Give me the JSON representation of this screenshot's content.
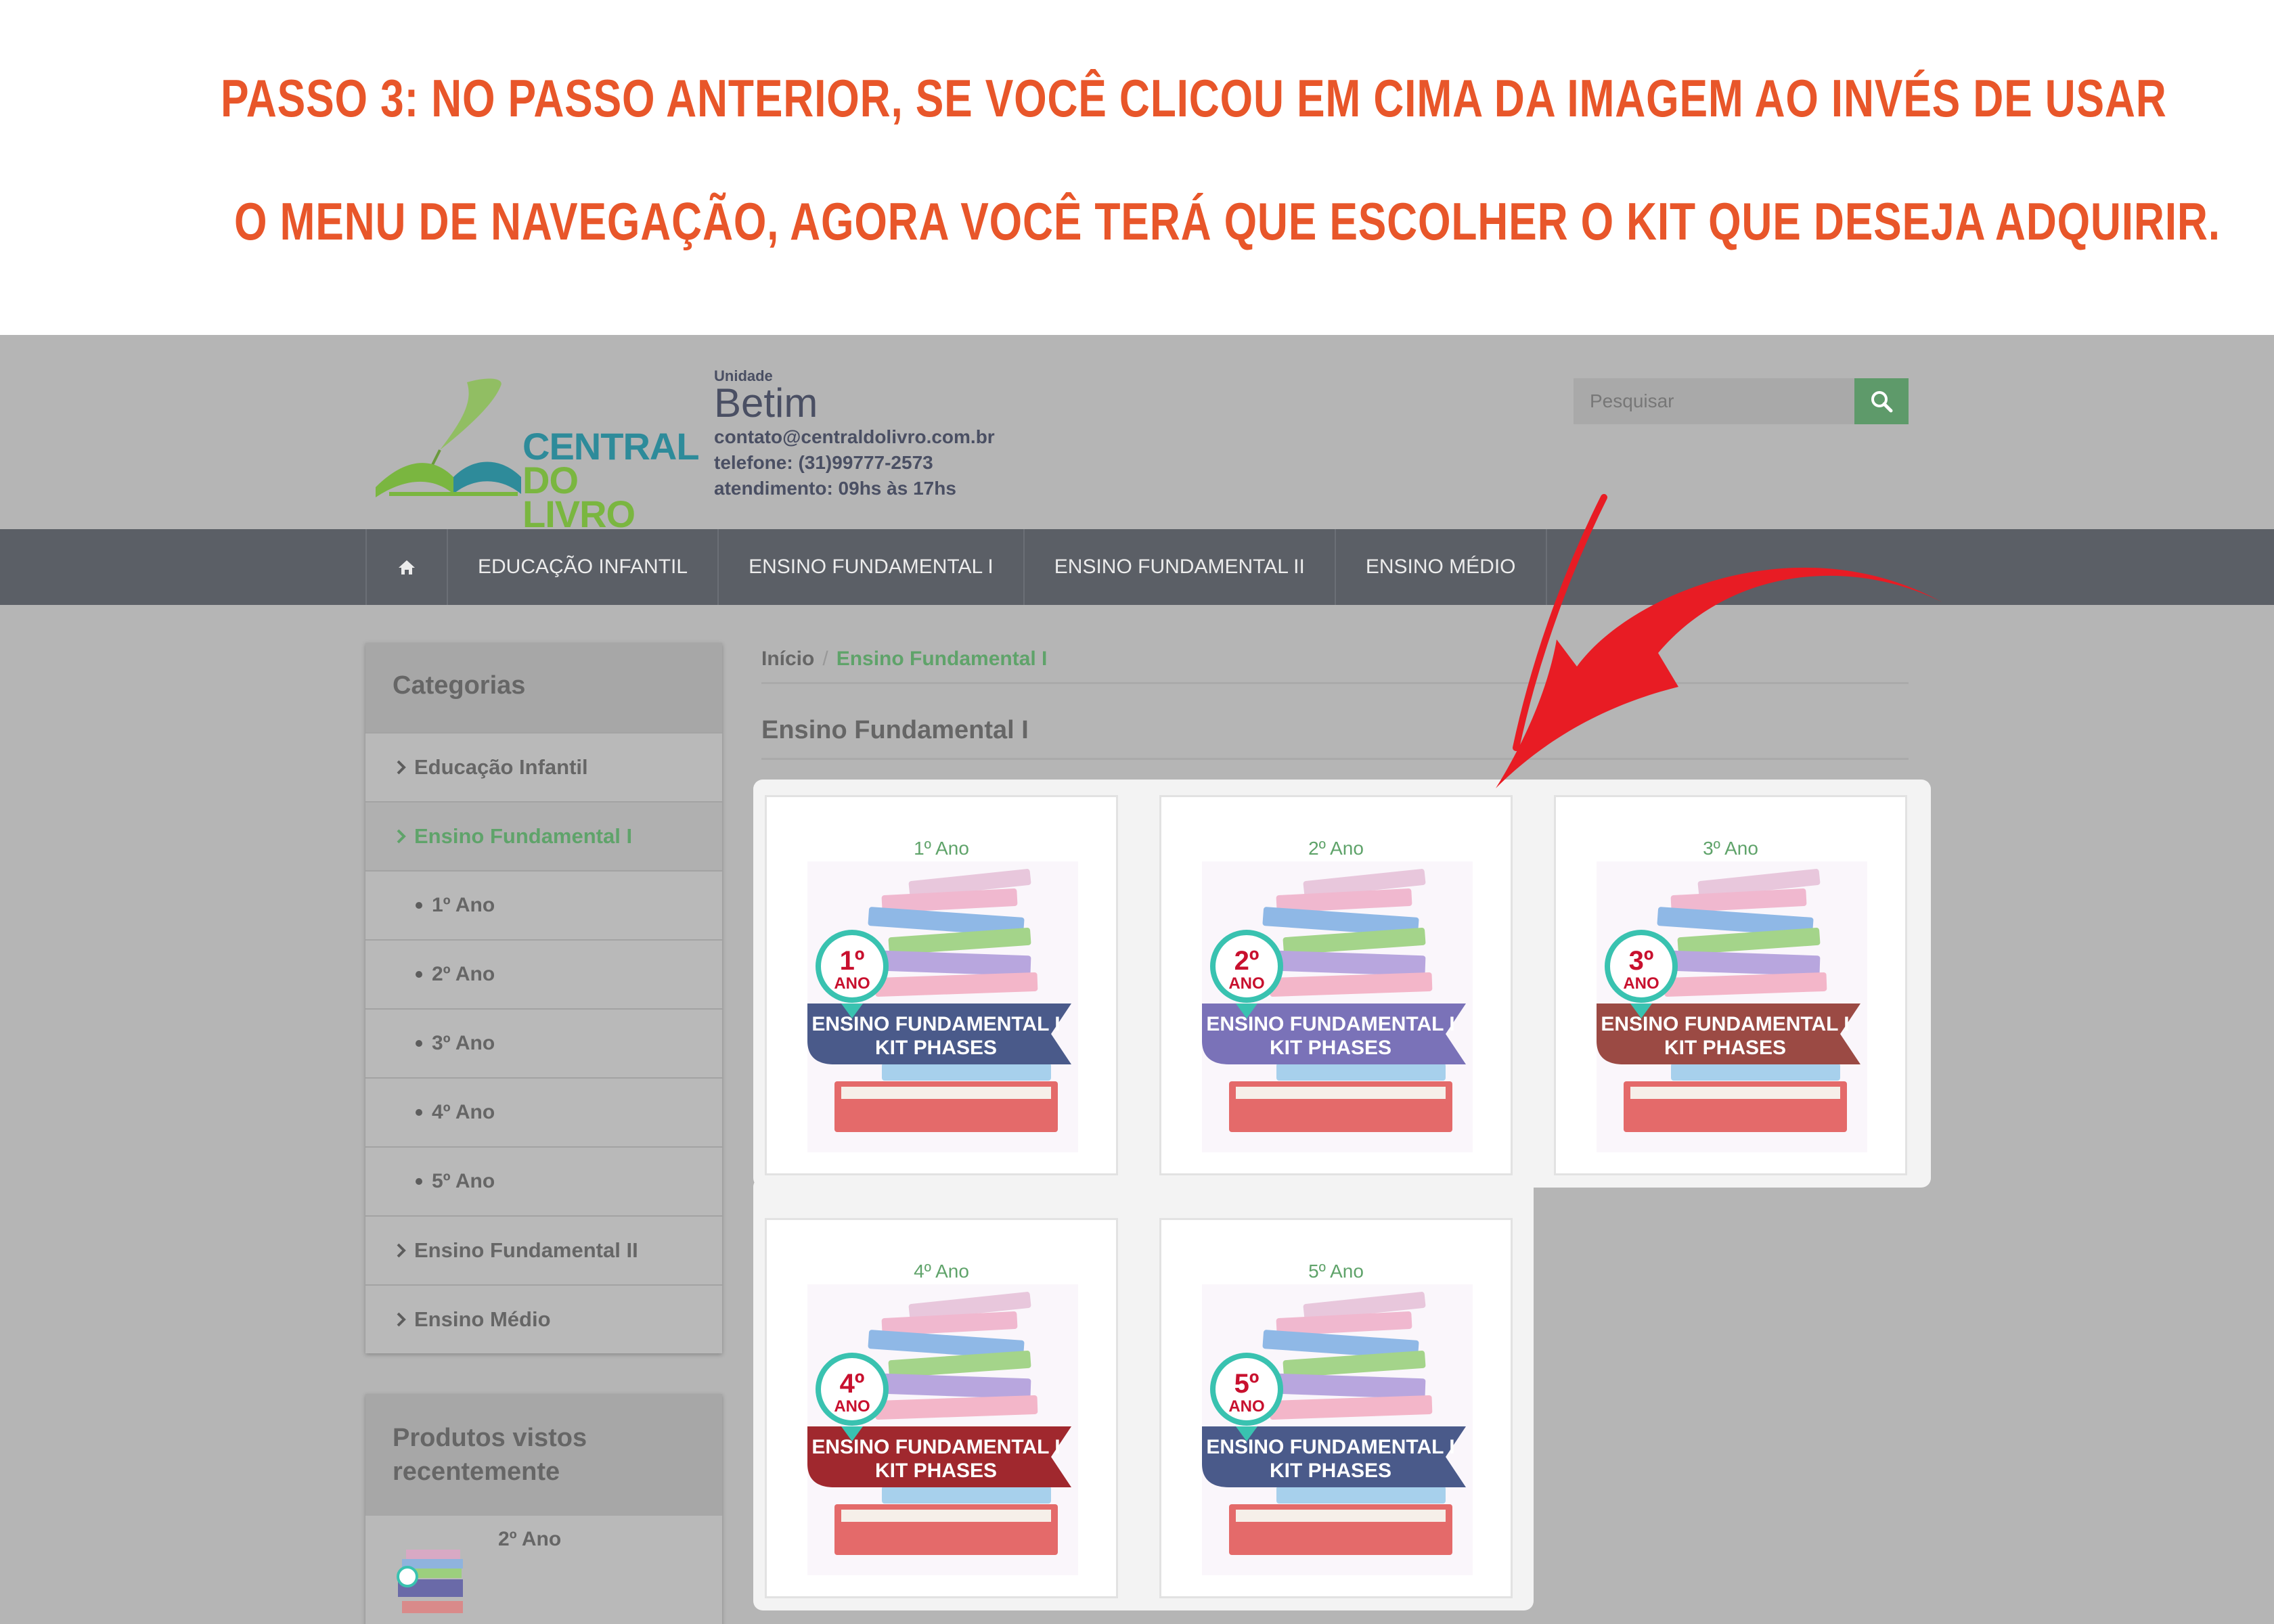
{
  "instructions": {
    "line1": "PASSO 3: NO PASSO ANTERIOR, SE VOCÊ CLICOU EM CIMA DA IMAGEM AO INVÉS DE USAR",
    "line2": "O MENU DE NAVEGAÇÃO, AGORA VOCÊ TERÁ QUE ESCOLHER O KIT QUE DESEJA ADQUIRIR."
  },
  "header": {
    "logo_line1": "CENTRAL",
    "logo_line2": "DO LIVRO",
    "unit_label": "Unidade",
    "unit_city": "Betim",
    "email": "contato@centraldolivro.com.br",
    "phone": "telefone: (31)99777-2573",
    "hours": "atendimento: 09hs às 17hs",
    "search_placeholder": "Pesquisar",
    "search_icon": "search-icon"
  },
  "nav": {
    "home_icon": "home-icon",
    "items": [
      "EDUCAÇÃO INFANTIL",
      "ENSINO FUNDAMENTAL I",
      "ENSINO FUNDAMENTAL II",
      "ENSINO MÉDIO"
    ]
  },
  "sidebar": {
    "title": "Categorias",
    "items": [
      {
        "label": "Educação Infantil"
      },
      {
        "label": "Ensino Fundamental I",
        "active": true
      },
      {
        "label": "1º Ano"
      },
      {
        "label": "2º Ano"
      },
      {
        "label": "3º Ano"
      },
      {
        "label": "4º Ano"
      },
      {
        "label": "5º Ano"
      },
      {
        "label": "Ensino Fundamental II"
      },
      {
        "label": "Ensino Médio"
      }
    ]
  },
  "recent": {
    "title": "Produtos vistos recentemente",
    "item_title": "2º Ano"
  },
  "breadcrumb": {
    "home": "Início",
    "sep": "/",
    "current": "Ensino Fundamental I"
  },
  "page_title": "Ensino Fundamental I",
  "products": [
    {
      "name": "1º Ano",
      "badge_num": "1º",
      "badge_word": "ANO",
      "ribbon1": "ENSINO FUNDAMENTAL I",
      "ribbon2": "KIT PHASES",
      "ribbon_color": "#4a5a8a"
    },
    {
      "name": "2º Ano",
      "badge_num": "2º",
      "badge_word": "ANO",
      "ribbon1": "ENSINO FUNDAMENTAL I",
      "ribbon2": "KIT PHASES",
      "ribbon_color": "#7a72b8"
    },
    {
      "name": "3º Ano",
      "badge_num": "3º",
      "badge_word": "ANO",
      "ribbon1": "ENSINO FUNDAMENTAL I",
      "ribbon2": "KIT PHASES",
      "ribbon_color": "#9b4a44"
    },
    {
      "name": "4º Ano",
      "badge_num": "4º",
      "badge_word": "ANO",
      "ribbon1": "ENSINO FUNDAMENTAL I",
      "ribbon2": "KIT PHASES",
      "ribbon_color": "#a0282e"
    },
    {
      "name": "5º Ano",
      "badge_num": "5º",
      "badge_word": "ANO",
      "ribbon1": "ENSINO FUNDAMENTAL I",
      "ribbon2": "KIT PHASES",
      "ribbon_color": "#4a5a8a"
    }
  ],
  "colors": {
    "accent_orange": "#e8562a",
    "brand_green": "#5fa36a",
    "nav_bg": "#5b5f66",
    "arrow_red": "#e81c24"
  }
}
